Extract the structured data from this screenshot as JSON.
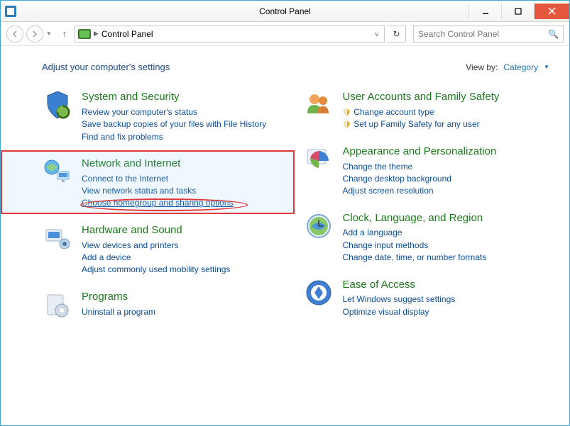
{
  "window": {
    "title": "Control Panel"
  },
  "nav": {
    "breadcrumb": "Control Panel",
    "search_placeholder": "Search Control Panel"
  },
  "header": {
    "lead": "Adjust your computer's settings",
    "view_by_label": "View by:",
    "view_by_value": "Category"
  },
  "left": [
    {
      "title": "System and Security",
      "links": [
        "Review your computer's status",
        "Save backup copies of your files with File History",
        "Find and fix problems"
      ]
    },
    {
      "title": "Network and Internet",
      "links": [
        "Connect to the Internet",
        "View network status and tasks",
        "Choose homegroup and sharing options"
      ],
      "highlighted": true
    },
    {
      "title": "Hardware and Sound",
      "links": [
        "View devices and printers",
        "Add a device",
        "Adjust commonly used mobility settings"
      ]
    },
    {
      "title": "Programs",
      "links": [
        "Uninstall a program"
      ]
    }
  ],
  "right": [
    {
      "title": "User Accounts and Family Safety",
      "links": [
        "Change account type",
        "Set up Family Safety for any user"
      ],
      "shielded": true
    },
    {
      "title": "Appearance and Personalization",
      "links": [
        "Change the theme",
        "Change desktop background",
        "Adjust screen resolution"
      ]
    },
    {
      "title": "Clock, Language, and Region",
      "links": [
        "Add a language",
        "Change input methods",
        "Change date, time, or number formats"
      ]
    },
    {
      "title": "Ease of Access",
      "links": [
        "Let Windows suggest settings",
        "Optimize visual display"
      ]
    }
  ]
}
